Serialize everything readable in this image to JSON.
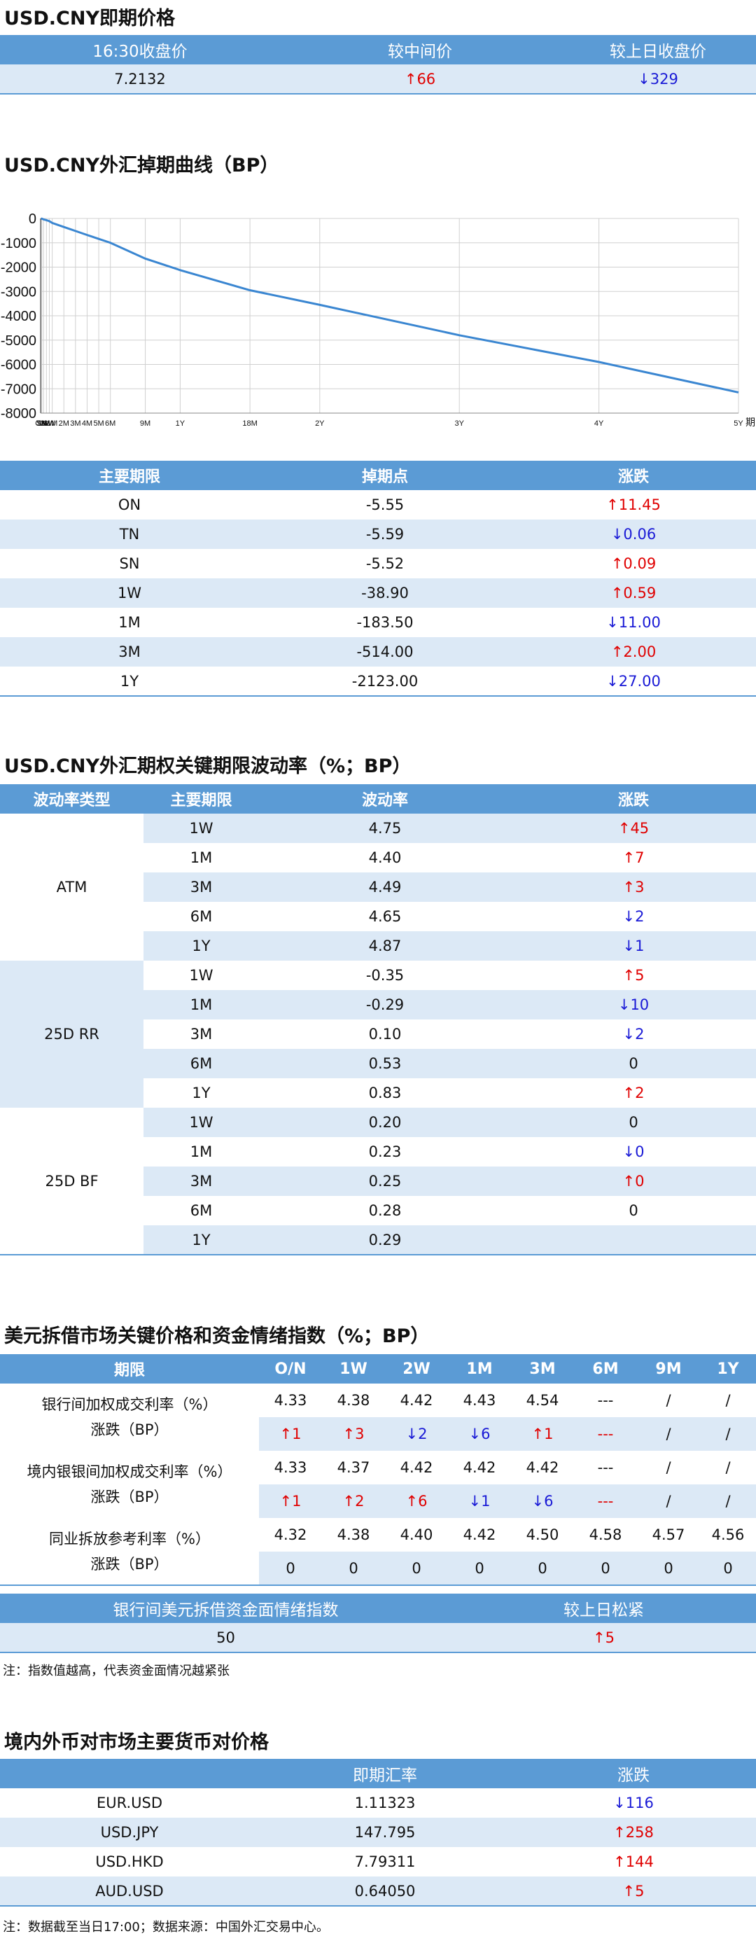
{
  "spot": {
    "title": "USD.CNY即期价格",
    "headers": [
      "16:30收盘价",
      "较中间价",
      "较上日收盘价"
    ],
    "close": "7.2132",
    "vs_mid": {
      "dir": "up",
      "text": "66"
    },
    "vs_prev": {
      "dir": "down",
      "text": "329"
    }
  },
  "curve": {
    "title": "USD.CNY外汇掉期曲线（BP）",
    "table_headers": [
      "主要期限",
      "掉期点",
      "涨跌"
    ],
    "rows": [
      {
        "tenor": "ON",
        "points": "-5.55",
        "dir": "up",
        "chg": "11.45"
      },
      {
        "tenor": "TN",
        "points": "-5.59",
        "dir": "down",
        "chg": "0.06"
      },
      {
        "tenor": "SN",
        "points": "-5.52",
        "dir": "up",
        "chg": "0.09"
      },
      {
        "tenor": "1W",
        "points": "-38.90",
        "dir": "up",
        "chg": "0.59"
      },
      {
        "tenor": "1M",
        "points": "-183.50",
        "dir": "down",
        "chg": "11.00"
      },
      {
        "tenor": "3M",
        "points": "-514.00",
        "dir": "up",
        "chg": "2.00"
      },
      {
        "tenor": "1Y",
        "points": "-2123.00",
        "dir": "down",
        "chg": "27.00"
      }
    ]
  },
  "chart_data": {
    "type": "line",
    "x_labels": [
      "ON",
      "TN",
      "SN",
      "1W",
      "2W",
      "3W",
      "1M",
      "2M",
      "3M",
      "4M",
      "5M",
      "6M",
      "9M",
      "1Y",
      "18M",
      "2Y",
      "3Y",
      "4Y",
      "5Y"
    ],
    "x_positions_months": [
      0.03,
      0.07,
      0.1,
      0.25,
      0.5,
      0.75,
      1,
      2,
      3,
      4,
      5,
      6,
      9,
      12,
      18,
      24,
      36,
      48,
      60
    ],
    "values": [
      -5.55,
      -5.59,
      -5.52,
      -38.9,
      -70,
      -110,
      -183.5,
      -350,
      -514,
      -680,
      -840,
      -1000,
      -1650,
      -2123,
      -2950,
      -3550,
      -4800,
      -5900,
      -7150
    ],
    "y_ticks": [
      "0",
      "-1000",
      "-2000",
      "-3000",
      "-4000",
      "-5000",
      "-6000",
      "-7000",
      "-8000"
    ],
    "ylim": [
      -8000,
      0
    ],
    "xlabel": "期",
    "grid": true,
    "line_color": "#3a86d1"
  },
  "vol": {
    "title": "USD.CNY外汇期权关键期限波动率（%；BP）",
    "headers": [
      "波动率类型",
      "主要期限",
      "波动率",
      "涨跌"
    ],
    "groups": [
      {
        "name": "ATM",
        "rows": [
          {
            "tenor": "1W",
            "vol": "4.75",
            "dir": "up",
            "chg": "45"
          },
          {
            "tenor": "1M",
            "vol": "4.40",
            "dir": "up",
            "chg": "7"
          },
          {
            "tenor": "3M",
            "vol": "4.49",
            "dir": "up",
            "chg": "3"
          },
          {
            "tenor": "6M",
            "vol": "4.65",
            "dir": "down",
            "chg": "2"
          },
          {
            "tenor": "1Y",
            "vol": "4.87",
            "dir": "down",
            "chg": "1"
          }
        ]
      },
      {
        "name": "25D RR",
        "rows": [
          {
            "tenor": "1W",
            "vol": "-0.35",
            "dir": "up",
            "chg": "5"
          },
          {
            "tenor": "1M",
            "vol": "-0.29",
            "dir": "down",
            "chg": "10"
          },
          {
            "tenor": "3M",
            "vol": "0.10",
            "dir": "down",
            "chg": "2"
          },
          {
            "tenor": "6M",
            "vol": "0.53",
            "dir": "flat",
            "chg": "0"
          },
          {
            "tenor": "1Y",
            "vol": "0.83",
            "dir": "up",
            "chg": "2"
          }
        ]
      },
      {
        "name": "25D BF",
        "rows": [
          {
            "tenor": "1W",
            "vol": "0.20",
            "dir": "flat",
            "chg": "0"
          },
          {
            "tenor": "1M",
            "vol": "0.23",
            "dir": "down",
            "chg": "0"
          },
          {
            "tenor": "3M",
            "vol": "0.25",
            "dir": "up",
            "chg": "0"
          },
          {
            "tenor": "6M",
            "vol": "0.28",
            "dir": "flat",
            "chg": "0"
          },
          {
            "tenor": "1Y",
            "vol": "0.29",
            "dir": "flat",
            "chg": ""
          }
        ]
      }
    ]
  },
  "lending": {
    "title": "美元拆借市场关键价格和资金情绪指数（%；BP）",
    "headers": [
      "期限",
      "O/N",
      "1W",
      "2W",
      "1M",
      "3M",
      "6M",
      "9M",
      "1Y"
    ],
    "groups": [
      {
        "label1": "银行间加权成交利率（%）",
        "label2": "涨跌（BP）",
        "rates": [
          "4.33",
          "4.38",
          "4.42",
          "4.43",
          "4.54",
          "---",
          "/",
          "/"
        ],
        "changes": [
          {
            "dir": "up",
            "text": "1"
          },
          {
            "dir": "up",
            "text": "3"
          },
          {
            "dir": "down",
            "text": "2"
          },
          {
            "dir": "down",
            "text": "6"
          },
          {
            "dir": "up",
            "text": "1"
          },
          {
            "dir": "dash",
            "text": "---"
          },
          {
            "dir": "flat",
            "text": "/"
          },
          {
            "dir": "flat",
            "text": "/"
          }
        ]
      },
      {
        "label1": "境内银银间加权成交利率（%）",
        "label2": "涨跌（BP）",
        "rates": [
          "4.33",
          "4.37",
          "4.42",
          "4.42",
          "4.42",
          "---",
          "/",
          "/"
        ],
        "changes": [
          {
            "dir": "up",
            "text": "1"
          },
          {
            "dir": "up",
            "text": "2"
          },
          {
            "dir": "up",
            "text": "6"
          },
          {
            "dir": "down",
            "text": "1"
          },
          {
            "dir": "down",
            "text": "6"
          },
          {
            "dir": "dash",
            "text": "---"
          },
          {
            "dir": "flat",
            "text": "/"
          },
          {
            "dir": "flat",
            "text": "/"
          }
        ]
      },
      {
        "label1": "同业拆放参考利率（%）",
        "label2": "涨跌（BP）",
        "rates": [
          "4.32",
          "4.38",
          "4.40",
          "4.42",
          "4.50",
          "4.58",
          "4.57",
          "4.56"
        ],
        "changes": [
          {
            "dir": "flat",
            "text": "0"
          },
          {
            "dir": "flat",
            "text": "0"
          },
          {
            "dir": "flat",
            "text": "0"
          },
          {
            "dir": "flat",
            "text": "0"
          },
          {
            "dir": "flat",
            "text": "0"
          },
          {
            "dir": "flat",
            "text": "0"
          },
          {
            "dir": "flat",
            "text": "0"
          },
          {
            "dir": "flat",
            "text": "0"
          }
        ]
      }
    ],
    "sentiment_headers": [
      "银行间美元拆借资金面情绪指数",
      "较上日松紧"
    ],
    "sentiment_value": "50",
    "sentiment_change": {
      "dir": "up",
      "text": "5"
    },
    "note": "注：指数值越高，代表资金面情况越紧张"
  },
  "fx": {
    "title": "境内外币对市场主要货币对价格",
    "headers": [
      "",
      "即期汇率",
      "涨跌"
    ],
    "rows": [
      {
        "pair": "EUR.USD",
        "rate": "1.11323",
        "dir": "down",
        "chg": "116"
      },
      {
        "pair": "USD.JPY",
        "rate": "147.795",
        "dir": "up",
        "chg": "258"
      },
      {
        "pair": "USD.HKD",
        "rate": "7.79311",
        "dir": "up",
        "chg": "144"
      },
      {
        "pair": "AUD.USD",
        "rate": "0.64050",
        "dir": "up",
        "chg": "5"
      }
    ],
    "note": "注：数据截至当日17:00；数据来源：中国外汇交易中心。"
  },
  "colors": {
    "header": "#5b9bd5",
    "light_row": "#dce9f6",
    "up": "#e00000",
    "down": "#1a1ad6"
  }
}
